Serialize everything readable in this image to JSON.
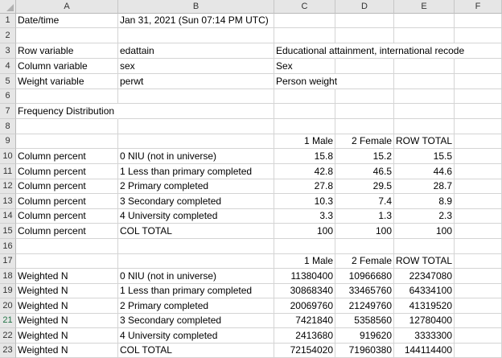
{
  "columns": [
    "A",
    "B",
    "C",
    "D",
    "E",
    "F"
  ],
  "rows": [
    {
      "n": "1",
      "cells": [
        {
          "c": 0,
          "v": "Date/time"
        },
        {
          "c": 1,
          "v": "Jan 31, 2021 (Sun 07:14 PM UTC)"
        }
      ]
    },
    {
      "n": "2",
      "cells": []
    },
    {
      "n": "3",
      "cells": [
        {
          "c": 0,
          "v": "Row variable"
        },
        {
          "c": 1,
          "v": "edattain"
        },
        {
          "c": 2,
          "v": "Educational attainment, international recode"
        }
      ]
    },
    {
      "n": "4",
      "cells": [
        {
          "c": 0,
          "v": "Column variable"
        },
        {
          "c": 1,
          "v": "sex"
        },
        {
          "c": 2,
          "v": "Sex"
        }
      ]
    },
    {
      "n": "5",
      "cells": [
        {
          "c": 0,
          "v": "Weight variable"
        },
        {
          "c": 1,
          "v": "perwt"
        },
        {
          "c": 2,
          "v": "Person weight"
        }
      ]
    },
    {
      "n": "6",
      "cells": []
    },
    {
      "n": "7",
      "cells": [
        {
          "c": 0,
          "v": "Frequency Distribution"
        }
      ]
    },
    {
      "n": "8",
      "cells": []
    },
    {
      "n": "9",
      "cells": [
        {
          "c": 2,
          "v": "1 Male",
          "num": true
        },
        {
          "c": 3,
          "v": "2 Female",
          "num": true
        },
        {
          "c": 4,
          "v": "ROW TOTAL",
          "num": true
        }
      ]
    },
    {
      "n": "10",
      "cells": [
        {
          "c": 0,
          "v": "Column percent"
        },
        {
          "c": 1,
          "v": "0 NIU (not in universe)"
        },
        {
          "c": 2,
          "v": "15.8",
          "num": true
        },
        {
          "c": 3,
          "v": "15.2",
          "num": true
        },
        {
          "c": 4,
          "v": "15.5",
          "num": true
        }
      ]
    },
    {
      "n": "11",
      "cells": [
        {
          "c": 0,
          "v": "Column percent"
        },
        {
          "c": 1,
          "v": "1 Less than primary completed"
        },
        {
          "c": 2,
          "v": "42.8",
          "num": true
        },
        {
          "c": 3,
          "v": "46.5",
          "num": true
        },
        {
          "c": 4,
          "v": "44.6",
          "num": true
        }
      ]
    },
    {
      "n": "12",
      "cells": [
        {
          "c": 0,
          "v": "Column percent"
        },
        {
          "c": 1,
          "v": "2 Primary completed"
        },
        {
          "c": 2,
          "v": "27.8",
          "num": true
        },
        {
          "c": 3,
          "v": "29.5",
          "num": true
        },
        {
          "c": 4,
          "v": "28.7",
          "num": true
        }
      ]
    },
    {
      "n": "13",
      "cells": [
        {
          "c": 0,
          "v": "Column percent"
        },
        {
          "c": 1,
          "v": "3 Secondary completed"
        },
        {
          "c": 2,
          "v": "10.3",
          "num": true
        },
        {
          "c": 3,
          "v": "7.4",
          "num": true
        },
        {
          "c": 4,
          "v": "8.9",
          "num": true
        }
      ]
    },
    {
      "n": "14",
      "cells": [
        {
          "c": 0,
          "v": "Column percent"
        },
        {
          "c": 1,
          "v": "4 University completed"
        },
        {
          "c": 2,
          "v": "3.3",
          "num": true
        },
        {
          "c": 3,
          "v": "1.3",
          "num": true
        },
        {
          "c": 4,
          "v": "2.3",
          "num": true
        }
      ]
    },
    {
      "n": "15",
      "cells": [
        {
          "c": 0,
          "v": "Column percent"
        },
        {
          "c": 1,
          "v": "COL TOTAL"
        },
        {
          "c": 2,
          "v": "100",
          "num": true
        },
        {
          "c": 3,
          "v": "100",
          "num": true
        },
        {
          "c": 4,
          "v": "100",
          "num": true
        }
      ]
    },
    {
      "n": "16",
      "cells": []
    },
    {
      "n": "17",
      "cells": [
        {
          "c": 2,
          "v": "1 Male",
          "num": true
        },
        {
          "c": 3,
          "v": "2 Female",
          "num": true
        },
        {
          "c": 4,
          "v": "ROW TOTAL",
          "num": true
        }
      ]
    },
    {
      "n": "18",
      "cells": [
        {
          "c": 0,
          "v": "Weighted N"
        },
        {
          "c": 1,
          "v": "0 NIU (not in universe)"
        },
        {
          "c": 2,
          "v": "11380400",
          "num": true
        },
        {
          "c": 3,
          "v": "10966680",
          "num": true
        },
        {
          "c": 4,
          "v": "22347080",
          "num": true
        }
      ]
    },
    {
      "n": "19",
      "cells": [
        {
          "c": 0,
          "v": "Weighted N"
        },
        {
          "c": 1,
          "v": "1 Less than primary completed"
        },
        {
          "c": 2,
          "v": "30868340",
          "num": true
        },
        {
          "c": 3,
          "v": "33465760",
          "num": true
        },
        {
          "c": 4,
          "v": "64334100",
          "num": true
        }
      ]
    },
    {
      "n": "20",
      "cells": [
        {
          "c": 0,
          "v": "Weighted N"
        },
        {
          "c": 1,
          "v": "2 Primary completed"
        },
        {
          "c": 2,
          "v": "20069760",
          "num": true
        },
        {
          "c": 3,
          "v": "21249760",
          "num": true
        },
        {
          "c": 4,
          "v": "41319520",
          "num": true
        }
      ]
    },
    {
      "n": "21",
      "cells": [
        {
          "c": 0,
          "v": "Weighted N"
        },
        {
          "c": 1,
          "v": "3 Secondary completed"
        },
        {
          "c": 2,
          "v": "7421840",
          "num": true
        },
        {
          "c": 3,
          "v": "5358560",
          "num": true
        },
        {
          "c": 4,
          "v": "12780400",
          "num": true
        }
      ]
    },
    {
      "n": "22",
      "cells": [
        {
          "c": 0,
          "v": "Weighted N"
        },
        {
          "c": 1,
          "v": "4 University completed"
        },
        {
          "c": 2,
          "v": "2413680",
          "num": true
        },
        {
          "c": 3,
          "v": "919620",
          "num": true
        },
        {
          "c": 4,
          "v": "3333300",
          "num": true
        }
      ]
    },
    {
      "n": "23",
      "cells": [
        {
          "c": 0,
          "v": "Weighted N"
        },
        {
          "c": 1,
          "v": "COL TOTAL"
        },
        {
          "c": 2,
          "v": "72154020",
          "num": true
        },
        {
          "c": 3,
          "v": "71960380",
          "num": true
        },
        {
          "c": 4,
          "v": "144114400",
          "num": true
        }
      ]
    }
  ],
  "selected_row": "21"
}
